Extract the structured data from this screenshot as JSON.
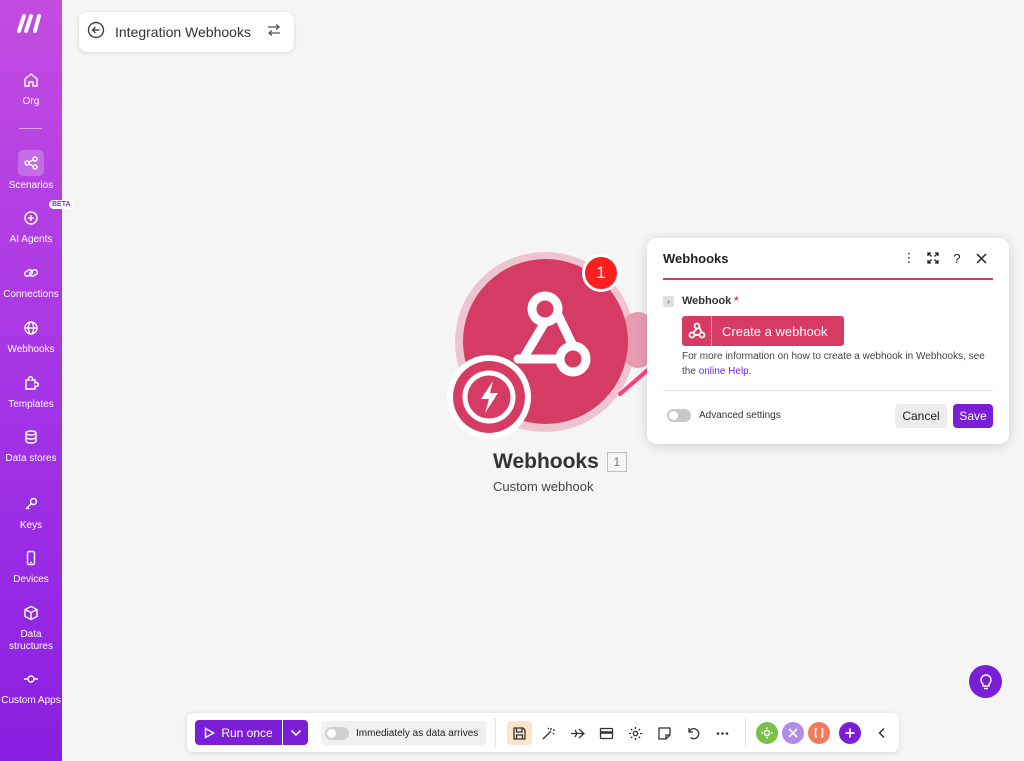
{
  "sidebar": {
    "items": [
      {
        "label": "Org",
        "icon": "home-icon"
      },
      {
        "label": "Scenarios",
        "icon": "share-nodes-icon"
      },
      {
        "label": "AI Agents",
        "icon": "ai-agent-icon",
        "badge": "BETA"
      },
      {
        "label": "Connections",
        "icon": "link-icon"
      },
      {
        "label": "Webhooks",
        "icon": "globe-icon"
      },
      {
        "label": "Templates",
        "icon": "puzzle-icon"
      },
      {
        "label": "Data stores",
        "icon": "database-icon"
      },
      {
        "label": "Keys",
        "icon": "key-icon"
      },
      {
        "label": "Devices",
        "icon": "phone-icon"
      },
      {
        "label": "Data structures",
        "icon": "cube-icon"
      },
      {
        "label": "Custom Apps",
        "icon": "commit-icon"
      }
    ]
  },
  "header": {
    "title": "Integration Webhooks"
  },
  "module": {
    "name": "Webhooks",
    "number": "1",
    "subtitle": "Custom webhook",
    "badge_count": "1",
    "color": "#d63b63"
  },
  "dialog": {
    "title": "Webhooks",
    "field_label": "Webhook",
    "required_mark": "*",
    "create_button": "Create a webhook",
    "help_prefix": "For more information on how to create a webhook in Webhooks, see the ",
    "help_link": "online Help",
    "help_suffix": ".",
    "advanced_label": "Advanced settings",
    "cancel_label": "Cancel",
    "save_label": "Save"
  },
  "toolbar": {
    "run_label": "Run once",
    "immediate_label": "Immediately as data arrives"
  },
  "colors": {
    "accent": "#7b1fd6",
    "webhook": "#d63b63",
    "notify": "#ff1f1f"
  }
}
